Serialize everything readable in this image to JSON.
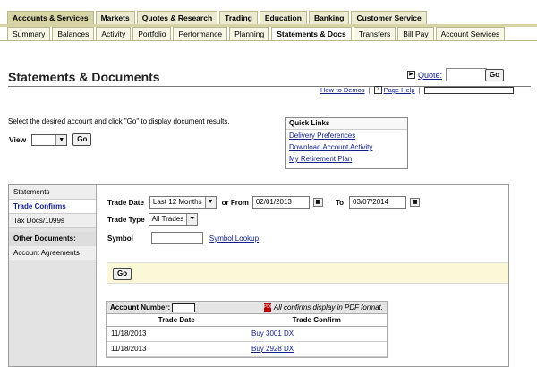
{
  "nav_primary": [
    "Accounts & Services",
    "Markets",
    "Quotes & Research",
    "Trading",
    "Education",
    "Banking",
    "Customer Service"
  ],
  "nav_secondary": [
    "Summary",
    "Balances",
    "Activity",
    "Portfolio",
    "Performance",
    "Planning",
    "Statements & Docs",
    "Transfers",
    "Bill Pay",
    "Account Services"
  ],
  "page": {
    "title": "Statements & Documents",
    "quote_label": "Quote:",
    "go_label": "Go",
    "howto_label": "How-to Demos",
    "help_label": "Page Help",
    "instructions": "Select the desired account and click \"Go\" to display document results.",
    "view_label": "View"
  },
  "quick_links": {
    "heading": "Quick Links",
    "items": [
      "Delivery Preferences",
      "Download Account Activity",
      "My Retirement Plan"
    ]
  },
  "sidebar": {
    "items": [
      "Statements",
      "Trade Confirms",
      "Tax Docs/1099s"
    ],
    "other_heading": "Other Documents:",
    "other_items": [
      "Account Agreements"
    ]
  },
  "form": {
    "trade_date_label": "Trade Date",
    "trade_date_value": "Last 12 Months",
    "or_from_label": "or From",
    "from_date": "02/01/2013",
    "to_label": "To",
    "to_date": "03/07/2014",
    "trade_type_label": "Trade Type",
    "trade_type_value": "All Trades",
    "symbol_label": "Symbol",
    "symbol_lookup": "Symbol Lookup",
    "go_label": "Go"
  },
  "results": {
    "account_number_label": "Account Number:",
    "pdf_note": "All confirms display in PDF format.",
    "columns": [
      "Trade Date",
      "Trade Confirm"
    ],
    "rows": [
      [
        "11/18/2013",
        "Buy  3001  DX"
      ],
      [
        "11/18/2013",
        "Buy  2928  DX"
      ]
    ]
  },
  "colors": {
    "tab_active": "#d6d4a6",
    "tab_bg": "#ecebd2",
    "link": "#12208c",
    "go_band": "#fbf8d8"
  }
}
